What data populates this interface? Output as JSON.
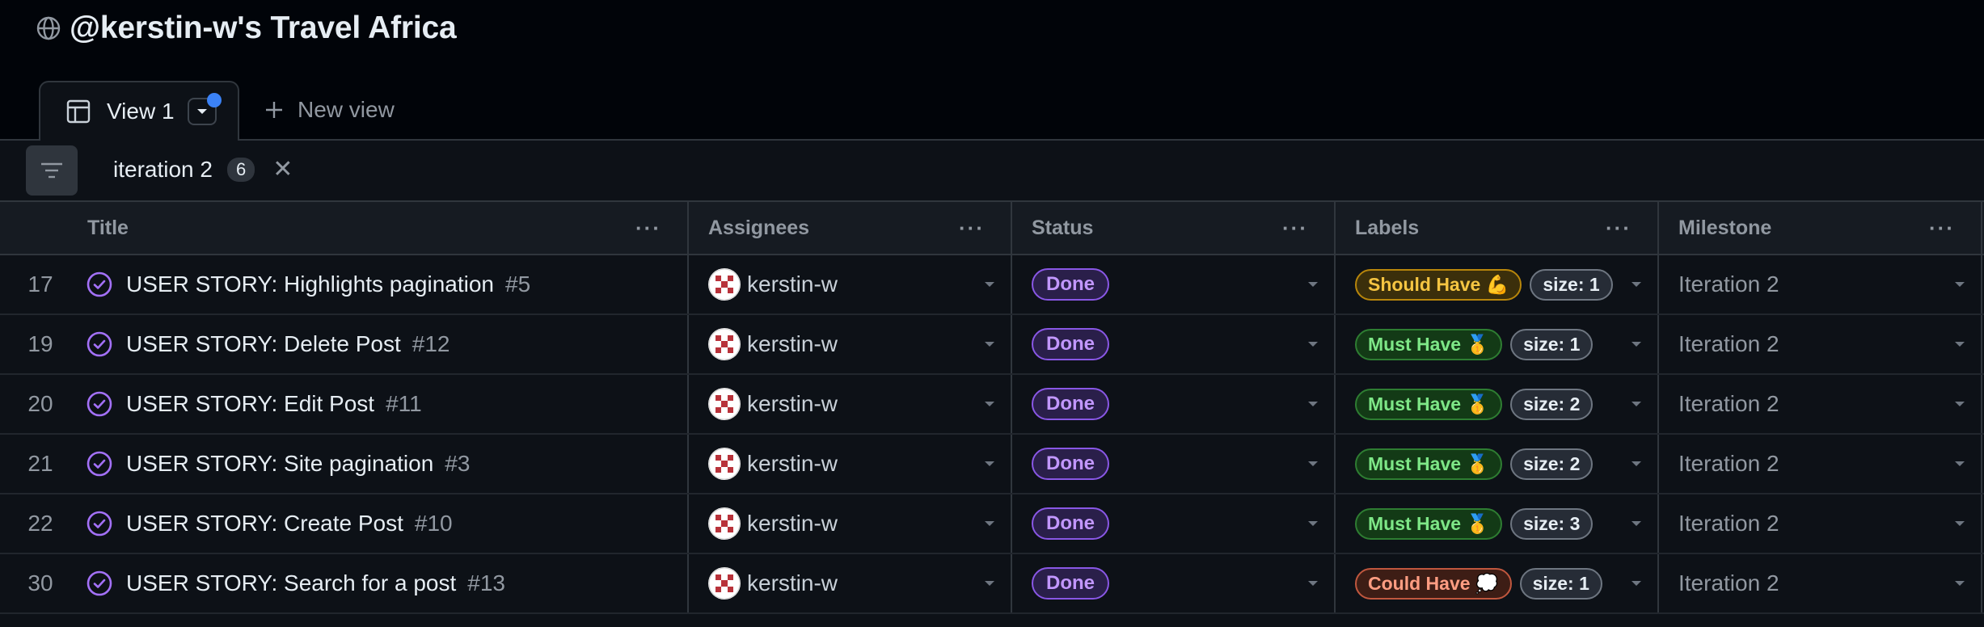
{
  "project": {
    "title": "@kerstin-w's Travel Africa",
    "icon": "globe-icon"
  },
  "views": {
    "active_tab": "View 1",
    "new_view_label": "New view"
  },
  "filter": {
    "query": "iteration 2",
    "count": "6"
  },
  "columns": [
    {
      "label": "Title"
    },
    {
      "label": "Assignees"
    },
    {
      "label": "Status"
    },
    {
      "label": "Labels"
    },
    {
      "label": "Milestone"
    }
  ],
  "rows": [
    {
      "num": "17",
      "title": "USER STORY: Highlights pagination",
      "issue": "#5",
      "assignee": "kerstin-w",
      "status": "Done",
      "priority": "Should Have 💪",
      "priority_kind": "should",
      "size": "size: 1",
      "milestone": "Iteration 2"
    },
    {
      "num": "19",
      "title": "USER STORY: Delete Post",
      "issue": "#12",
      "assignee": "kerstin-w",
      "status": "Done",
      "priority": "Must Have 🥇",
      "priority_kind": "must",
      "size": "size: 1",
      "milestone": "Iteration 2"
    },
    {
      "num": "20",
      "title": "USER STORY: Edit Post",
      "issue": "#11",
      "assignee": "kerstin-w",
      "status": "Done",
      "priority": "Must Have 🥇",
      "priority_kind": "must",
      "size": "size: 2",
      "milestone": "Iteration 2"
    },
    {
      "num": "21",
      "title": "USER STORY: Site pagination",
      "issue": "#3",
      "assignee": "kerstin-w",
      "status": "Done",
      "priority": "Must Have 🥇",
      "priority_kind": "must",
      "size": "size: 2",
      "milestone": "Iteration 2"
    },
    {
      "num": "22",
      "title": "USER STORY: Create Post",
      "issue": "#10",
      "assignee": "kerstin-w",
      "status": "Done",
      "priority": "Must Have 🥇",
      "priority_kind": "must",
      "size": "size: 3",
      "milestone": "Iteration 2"
    },
    {
      "num": "30",
      "title": "USER STORY: Search for a post",
      "issue": "#13",
      "assignee": "kerstin-w",
      "status": "Done",
      "priority": "Could Have 💭",
      "priority_kind": "could",
      "size": "size: 1",
      "milestone": "Iteration 2"
    }
  ],
  "colors": {
    "background": "#0d1117",
    "status_done": "#8957e5",
    "label_should": "#f5c542",
    "label_must": "#7ee787",
    "label_could": "#ff9d82"
  }
}
